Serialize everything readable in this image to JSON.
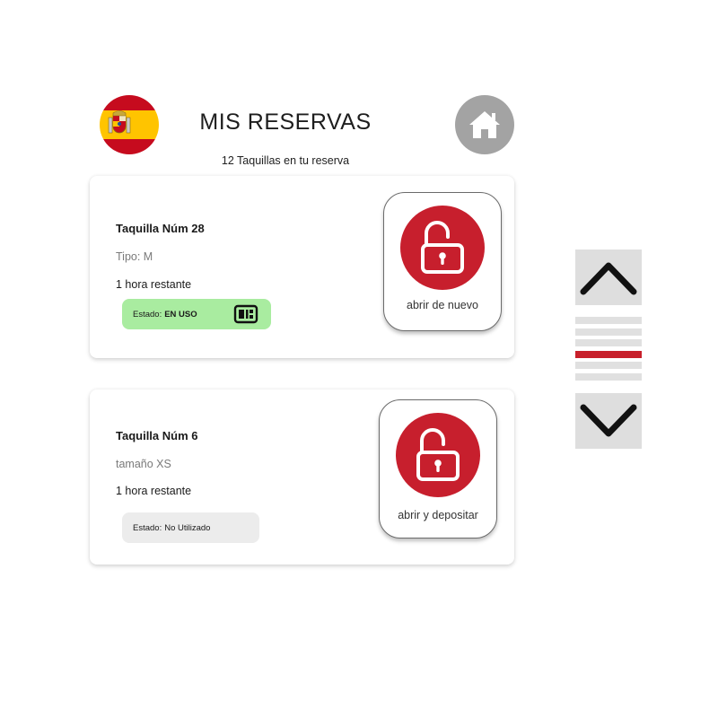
{
  "header": {
    "title": "MIS RESERVAS",
    "subtitle": "12 Taquillas en tu reserva",
    "language_flag": "spain-flag",
    "home_icon": "home-icon"
  },
  "reservations": [
    {
      "name": "Taquilla Núm 28",
      "meta": "Tipo: M",
      "time_left": "1 hora restante",
      "status_label": "Estado:",
      "status_value": "EN USO",
      "status_color": "#a9eca0",
      "status_icon": "qr-code-icon",
      "action_label": "abrir de nuevo",
      "action_icon": "unlock-icon"
    },
    {
      "name": "Taquilla Núm 6",
      "meta": "tamaño XS",
      "time_left": "1 hora restante",
      "status_label": "Estado:",
      "status_value": "No Utilizado",
      "status_color": "#ececec",
      "action_label": "abrir y depositar",
      "action_icon": "unlock-icon"
    }
  ],
  "scroll": {
    "up_icon": "chevron-up-icon",
    "down_icon": "chevron-down-icon",
    "page_count": 6,
    "active_page": 4
  },
  "colors": {
    "accent_red": "#c71f2d",
    "home_button": "#a3a3a3",
    "in_use_green": "#a9eca0",
    "scroll_bg": "#dedede"
  }
}
